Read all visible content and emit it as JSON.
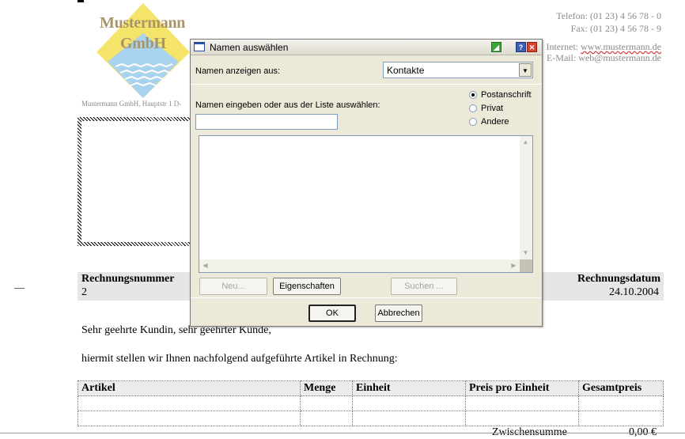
{
  "document": {
    "company_name_line1": "Mustermann",
    "company_name_line2": "GmbH",
    "phone": "Telefon: (01 23) 4 56 78 - 0",
    "fax": "Fax: (01 23) 4 56 78 - 9",
    "internet_label": "Internet:",
    "internet_url": "www.mustermann.de",
    "email": "E-Mail: web@mustermann.de",
    "sender_line": "Mustermann GmbH, Hauptstr 1 D-",
    "invoice_number_label": "Rechnungsnummer",
    "invoice_number": "2",
    "invoice_date_label": "Rechnungsdatum",
    "invoice_date": "24.10.2004",
    "salutation": "Sehr geehrte Kundin, sehr geehrter Kunde,",
    "intro": "hiermit stellen wir Ihnen nachfolgend aufgeführte Artikel in Rechnung:",
    "table_headers": [
      "Artikel",
      "Menge",
      "Einheit",
      "Preis pro Einheit",
      "Gesamtpreis"
    ],
    "subtotal_label": "Zwischensumme",
    "subtotal_value": "0,00 €"
  },
  "dialog": {
    "title": "Namen auswählen",
    "show_names_from_label": "Namen anzeigen aus:",
    "source_selected": "Kontakte",
    "enter_name_label": "Namen eingeben oder aus der Liste auswählen:",
    "name_input_value": "",
    "address_type_options": [
      "Postanschrift",
      "Privat",
      "Andere"
    ],
    "address_type_selected": "Postanschrift",
    "buttons": {
      "new": "Neu...",
      "properties": "Eigenschaften",
      "find": "Suchen ...",
      "ok": "OK",
      "cancel": "Abbrechen"
    }
  }
}
